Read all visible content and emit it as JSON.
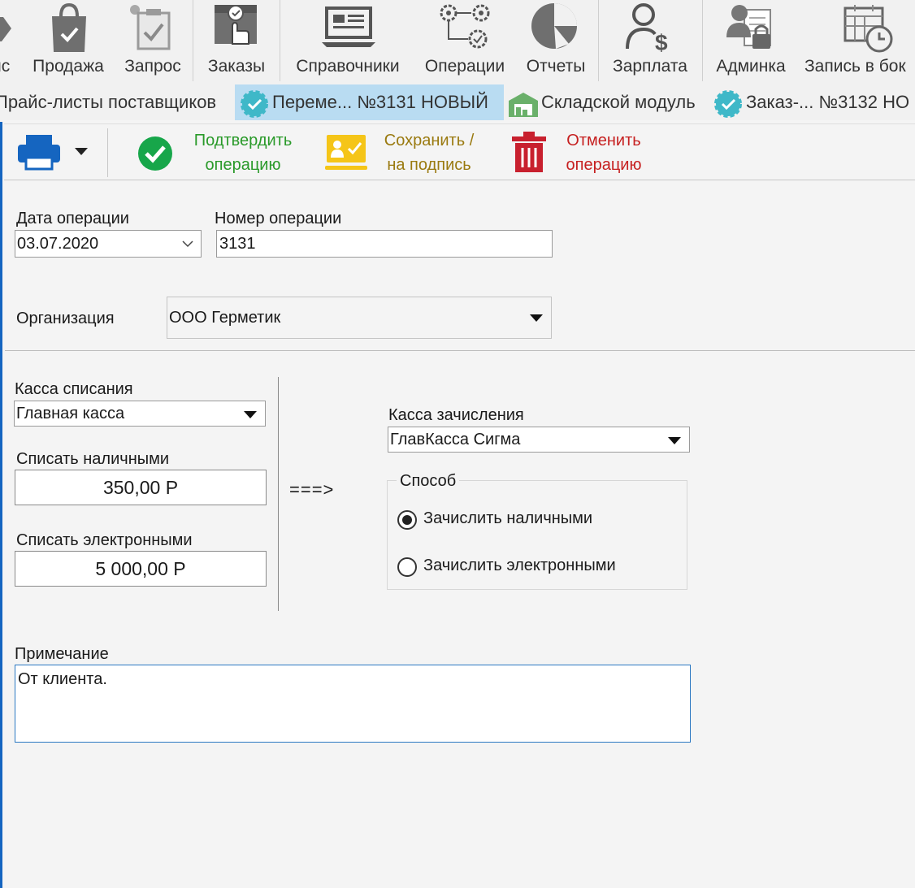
{
  "ribbon": {
    "items": [
      {
        "label": "йс",
        "icon": "tag-icon"
      },
      {
        "label": "Продажа",
        "icon": "shopping-bag-icon"
      },
      {
        "label": "Запрос",
        "icon": "clipboard-check-icon"
      },
      {
        "label": "Заказы",
        "icon": "box-hand-icon"
      },
      {
        "label": "Справочники",
        "icon": "laptop-icon"
      },
      {
        "label": "Операции",
        "icon": "gears-flow-icon"
      },
      {
        "label": "Отчеты",
        "icon": "pie-chart-icon"
      },
      {
        "label": "Зарплата",
        "icon": "user-dollar-icon"
      },
      {
        "label": "Админка",
        "icon": "admin-lock-icon"
      },
      {
        "label": "Запись в бок",
        "icon": "calendar-clock-icon"
      }
    ]
  },
  "tabs": [
    {
      "label": "Прайс-листы поставщиков"
    },
    {
      "label": "Переме... №3131 НОВЫЙ",
      "active": true
    },
    {
      "label": "Складской модуль"
    },
    {
      "label": "Заказ-... №3132 НО"
    }
  ],
  "toolbar": {
    "confirm_label": "Подтвердить\nоперацию",
    "save_label": "Сохранить /\nна подпись",
    "cancel_label": "Отменить\nоперацию",
    "colors": {
      "confirm": "#2a9a2a",
      "save": "#9a7a10",
      "cancel": "#c62020",
      "print": "#1565c0"
    }
  },
  "form": {
    "date_label": "Дата операции",
    "date_value": "03.07.2020",
    "number_label": "Номер операции",
    "number_value": "3131",
    "org_label": "Организация",
    "org_value": "ООО Герметик",
    "source_label": "Касса списания",
    "source_value": "Главная касса",
    "cash_label": "Списать наличными",
    "cash_value": "350,00 Р",
    "electronic_label": "Списать электронными",
    "electronic_value": "5 000,00 Р",
    "arrow": "===>",
    "target_label": "Касса зачисления",
    "target_value": "ГлавКасса Сигма",
    "method_label": "Способ",
    "method_options": [
      {
        "label": "Зачислить наличными",
        "selected": true
      },
      {
        "label": "Зачислить электронными",
        "selected": false
      }
    ],
    "note_label": "Примечание",
    "note_value": "От клиента."
  }
}
